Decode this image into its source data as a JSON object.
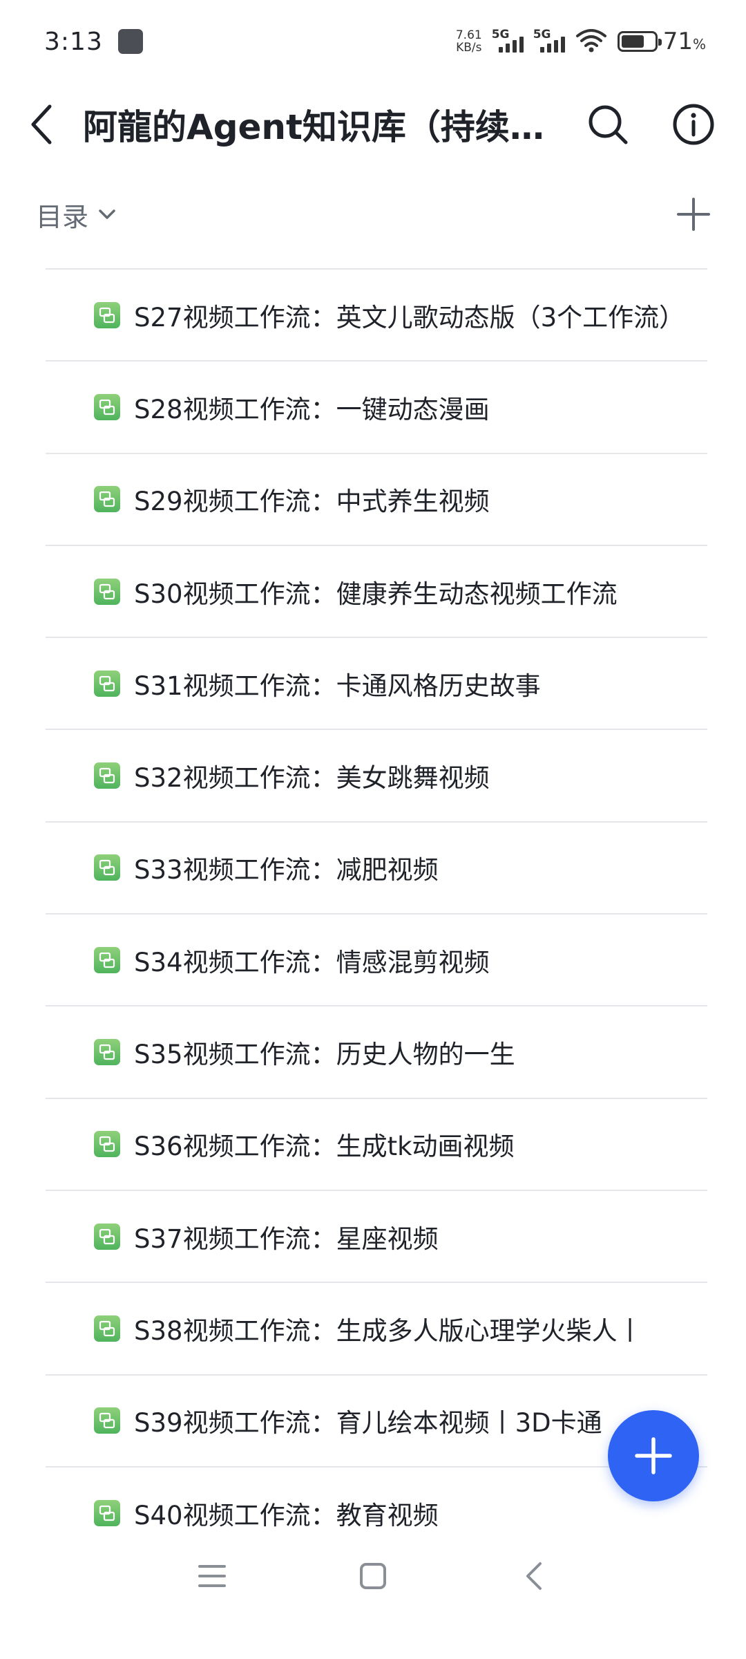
{
  "status_bar": {
    "time": "3:13",
    "speed_value": "7.61",
    "speed_unit": "KB/s",
    "net1": "5G",
    "net2": "5G",
    "battery_percent": "71",
    "battery_symbol": "%",
    "battery_level": 0.71
  },
  "header": {
    "title": "阿龍的Agent知识库（持续更…",
    "back_icon": "chevron-left-icon",
    "search_icon": "search-icon",
    "info_icon": "info-icon"
  },
  "toolbar": {
    "toc_label": "目录",
    "add_icon": "plus-icon"
  },
  "list": {
    "items": [
      {
        "label": "S27视频工作流：英文儿歌动态版（3个工作流）"
      },
      {
        "label": "S28视频工作流：一键动态漫画"
      },
      {
        "label": "S29视频工作流：中式养生视频"
      },
      {
        "label": "S30视频工作流：健康养生动态视频工作流"
      },
      {
        "label": "S31视频工作流：卡通风格历史故事"
      },
      {
        "label": "S32视频工作流：美女跳舞视频"
      },
      {
        "label": "S33视频工作流：减肥视频"
      },
      {
        "label": "S34视频工作流：情感混剪视频"
      },
      {
        "label": "S35视频工作流：历史人物的一生"
      },
      {
        "label": "S36视频工作流：生成tk动画视频"
      },
      {
        "label": "S37视频工作流：星座视频"
      },
      {
        "label": "S38视频工作流：生成多人版心理学火柴人丨"
      },
      {
        "label": "S39视频工作流：育儿绘本视频丨3D卡通"
      },
      {
        "label": "S40视频工作流：教育视频"
      }
    ]
  },
  "colors": {
    "accent": "#2f63f4",
    "doc_icon": "#5cba63",
    "divider": "#e4e6e9"
  }
}
